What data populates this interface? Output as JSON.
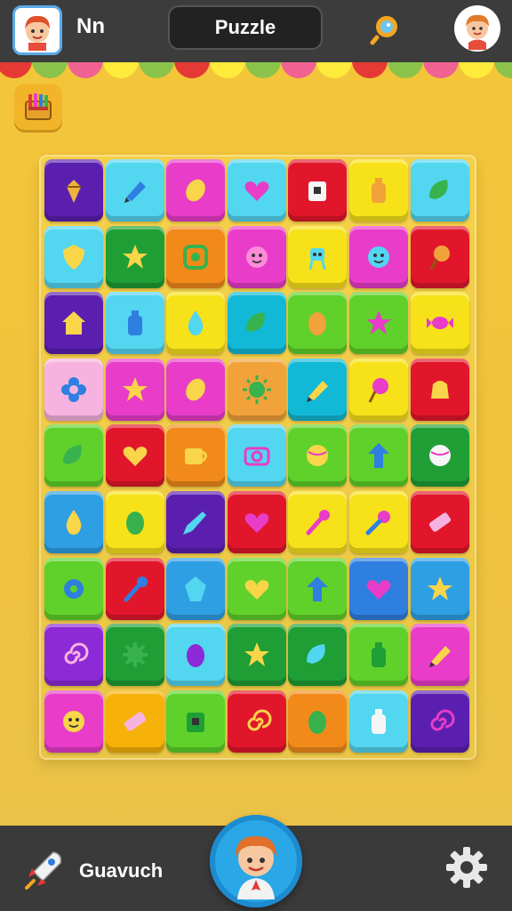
{
  "header": {
    "player_name": "Nn",
    "title": "Puzzle",
    "player_avatar_icon": "boy-avatar-icon",
    "hint_icon": "magnifier-icon",
    "profile_icon": "girl-avatar-icon"
  },
  "scallop_colors": [
    "#e53935",
    "#8bc34a",
    "#f06292",
    "#ffeb3b",
    "#8bc34a",
    "#e53935",
    "#ffeb3b",
    "#8bc34a",
    "#f06292",
    "#ffeb3b",
    "#e53935",
    "#8bc34a",
    "#f06292",
    "#ffeb3b",
    "#8bc34a"
  ],
  "menu_icon": "crayon-box-icon",
  "board": {
    "rows": 9,
    "cols": 7,
    "tiles": [
      [
        {
          "c": "#5b1fb0",
          "i": "cone",
          "ic": "#f0b43c"
        },
        {
          "c": "#53d6ef",
          "i": "crayon",
          "ic": "#2f7fe0"
        },
        {
          "c": "#e83cc9",
          "i": "lemon",
          "ic": "#f9d54a"
        },
        {
          "c": "#53d6ef",
          "i": "heart",
          "ic": "#e83cc9"
        },
        {
          "c": "#e2162b",
          "i": "box",
          "ic": "#f5f5f5"
        },
        {
          "c": "#f7e21a",
          "i": "bottle",
          "ic": "#f2a23a"
        },
        {
          "c": "#53d6ef",
          "i": "leaf",
          "ic": "#37b24d"
        }
      ],
      [
        {
          "c": "#53d6ef",
          "i": "shield",
          "ic": "#f9d54a"
        },
        {
          "c": "#1f9e35",
          "i": "star",
          "ic": "#f9d54a"
        },
        {
          "c": "#f28a1a",
          "i": "badge",
          "ic": "#37b24d"
        },
        {
          "c": "#e83cc9",
          "i": "face",
          "ic": "#ff8ad8"
        },
        {
          "c": "#f7e21a",
          "i": "robot",
          "ic": "#53d6ef"
        },
        {
          "c": "#e83cc9",
          "i": "face",
          "ic": "#53d6ef"
        },
        {
          "c": "#e2162b",
          "i": "icecream",
          "ic": "#f2a23a"
        }
      ],
      [
        {
          "c": "#5b1fb0",
          "i": "house",
          "ic": "#f9d54a"
        },
        {
          "c": "#53d6ef",
          "i": "bottle",
          "ic": "#2f7fe0"
        },
        {
          "c": "#f7e21a",
          "i": "drop",
          "ic": "#53d6ef"
        },
        {
          "c": "#12b9d6",
          "i": "leaf",
          "ic": "#37b24d"
        },
        {
          "c": "#5fd12a",
          "i": "egg",
          "ic": "#f2a23a"
        },
        {
          "c": "#5fd12a",
          "i": "star",
          "ic": "#e83cc9"
        },
        {
          "c": "#f7e21a",
          "i": "candy",
          "ic": "#e83cc9"
        }
      ],
      [
        {
          "c": "#f7b3e0",
          "i": "flower",
          "ic": "#2f7fe0"
        },
        {
          "c": "#e83cc9",
          "i": "star",
          "ic": "#f9d54a"
        },
        {
          "c": "#e83cc9",
          "i": "lemon",
          "ic": "#f9d54a"
        },
        {
          "c": "#f2a23a",
          "i": "sun",
          "ic": "#37b24d"
        },
        {
          "c": "#12b9d6",
          "i": "crayon",
          "ic": "#f9d54a"
        },
        {
          "c": "#f7e21a",
          "i": "icecream",
          "ic": "#e83cc9"
        },
        {
          "c": "#e2162b",
          "i": "bell",
          "ic": "#f9d54a"
        }
      ],
      [
        {
          "c": "#5fd12a",
          "i": "leaf",
          "ic": "#37b24d"
        },
        {
          "c": "#e2162b",
          "i": "heart",
          "ic": "#f9d54a"
        },
        {
          "c": "#f28a1a",
          "i": "cup",
          "ic": "#f9d54a"
        },
        {
          "c": "#53d6ef",
          "i": "camera",
          "ic": "#e83cc9"
        },
        {
          "c": "#5fd12a",
          "i": "ball",
          "ic": "#f9d54a"
        },
        {
          "c": "#5fd12a",
          "i": "arrow",
          "ic": "#2f7fe0"
        },
        {
          "c": "#1f9e35",
          "i": "ball",
          "ic": "#f5f5f5"
        }
      ],
      [
        {
          "c": "#2f9fe3",
          "i": "drop",
          "ic": "#f9d54a"
        },
        {
          "c": "#f7e21a",
          "i": "egg",
          "ic": "#37b24d"
        },
        {
          "c": "#5b1fb0",
          "i": "rocket",
          "ic": "#53d6ef"
        },
        {
          "c": "#e2162b",
          "i": "heart",
          "ic": "#e83cc9"
        },
        {
          "c": "#f7e21a",
          "i": "wand",
          "ic": "#e83cc9"
        },
        {
          "c": "#f7e21a",
          "i": "mic",
          "ic": "#e83cc9"
        },
        {
          "c": "#e2162b",
          "i": "eraser",
          "ic": "#f7b3e0"
        }
      ],
      [
        {
          "c": "#5fd12a",
          "i": "donut",
          "ic": "#2f7fe0"
        },
        {
          "c": "#e2162b",
          "i": "wand",
          "ic": "#2f7fe0"
        },
        {
          "c": "#2f9fe3",
          "i": "gem",
          "ic": "#53d6ef"
        },
        {
          "c": "#5fd12a",
          "i": "heart",
          "ic": "#f9d54a"
        },
        {
          "c": "#5fd12a",
          "i": "arrow",
          "ic": "#2f7fe0"
        },
        {
          "c": "#2f7fe0",
          "i": "heart",
          "ic": "#e83cc9"
        },
        {
          "c": "#2f9fe3",
          "i": "star",
          "ic": "#f9d54a"
        }
      ],
      [
        {
          "c": "#8b2ad6",
          "i": "swirl",
          "ic": "#f7b3e0"
        },
        {
          "c": "#1f9e35",
          "i": "gear",
          "ic": "#37b24d"
        },
        {
          "c": "#53d6ef",
          "i": "egg",
          "ic": "#8b2ad6"
        },
        {
          "c": "#1f9e35",
          "i": "star",
          "ic": "#f9d54a"
        },
        {
          "c": "#1f9e35",
          "i": "leaf",
          "ic": "#53d6ef"
        },
        {
          "c": "#5fd12a",
          "i": "bottle",
          "ic": "#1f9e35"
        },
        {
          "c": "#e83cc9",
          "i": "crayon",
          "ic": "#f9d54a"
        }
      ],
      [
        {
          "c": "#e83cc9",
          "i": "face",
          "ic": "#f9d54a"
        },
        {
          "c": "#f7b20a",
          "i": "eraser",
          "ic": "#f7b3e0"
        },
        {
          "c": "#5fd12a",
          "i": "box",
          "ic": "#1f9e35"
        },
        {
          "c": "#e2162b",
          "i": "swirl",
          "ic": "#f9d54a"
        },
        {
          "c": "#f28a1a",
          "i": "egg",
          "ic": "#37b24d"
        },
        {
          "c": "#53d6ef",
          "i": "bottle",
          "ic": "#f5f5f5"
        },
        {
          "c": "#5b1fb0",
          "i": "swirl",
          "ic": "#e83cc9"
        }
      ]
    ]
  },
  "footer": {
    "left_icon": "rocket-icon",
    "label": "Guavuch",
    "center_icon": "boy-avatar-icon",
    "settings_icon": "gear-icon"
  }
}
